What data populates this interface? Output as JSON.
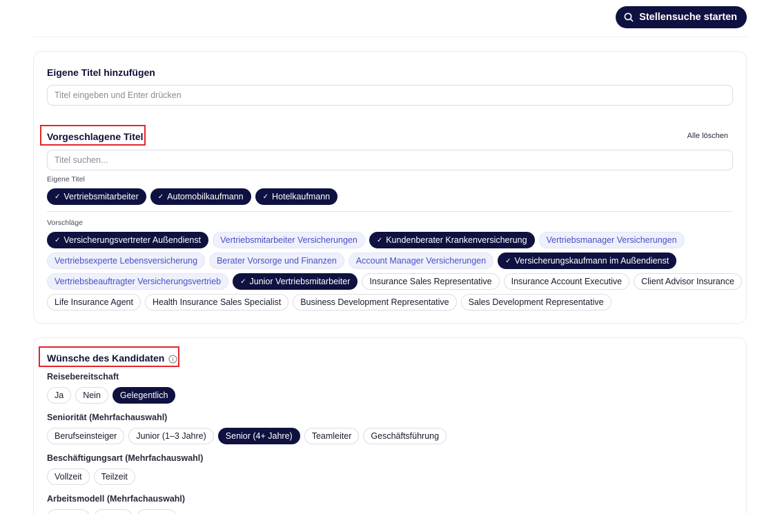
{
  "header": {
    "search_button_label": "Stellensuche starten"
  },
  "custom_titles": {
    "heading": "Eigene Titel hinzufügen",
    "placeholder": "Titel eingeben und Enter drücken"
  },
  "suggested_titles": {
    "heading": "Vorgeschlagene Titel",
    "clear_all": "Alle löschen",
    "search_placeholder": "Titel suchen...",
    "own_label": "Eigene Titel",
    "own": [
      "Vertriebsmitarbeiter",
      "Automobilkaufmann",
      "Hotelkaufmann"
    ],
    "suggestions_label": "Vorschläge",
    "rows": [
      [
        {
          "label": "Versicherungsvertreter Außendienst",
          "state": "selected"
        },
        {
          "label": "Vertriebsmitarbeiter Versicherungen",
          "state": "suggest"
        },
        {
          "label": "Kundenberater Krankenversicherung",
          "state": "selected"
        },
        {
          "label": "Vertriebsmanager Versicherungen",
          "state": "suggest"
        }
      ],
      [
        {
          "label": "Vertriebsexperte Lebensversicherung",
          "state": "suggest"
        },
        {
          "label": "Berater Vorsorge und Finanzen",
          "state": "suggest"
        },
        {
          "label": "Account Manager Versicherungen",
          "state": "suggest"
        },
        {
          "label": "Versicherungskaufmann im Außendienst",
          "state": "selected"
        }
      ],
      [
        {
          "label": "Vertriebsbeauftragter Versicherungsvertrieb",
          "state": "suggest"
        },
        {
          "label": "Junior Vertriebsmitarbeiter",
          "state": "selected"
        },
        {
          "label": "Insurance Sales Representative",
          "state": "plain"
        },
        {
          "label": "Insurance Account Executive",
          "state": "plain"
        },
        {
          "label": "Client Advisor Insurance",
          "state": "plain"
        }
      ],
      [
        {
          "label": "Life Insurance Agent",
          "state": "plain"
        },
        {
          "label": "Health Insurance Sales Specialist",
          "state": "plain"
        },
        {
          "label": "Business Development Representative",
          "state": "plain"
        },
        {
          "label": "Sales Development Representative",
          "state": "plain"
        }
      ]
    ]
  },
  "candidate": {
    "heading": "Wünsche des Kandidaten",
    "travel": {
      "label": "Reisebereitschaft",
      "options": [
        {
          "label": "Ja",
          "state": "plain"
        },
        {
          "label": "Nein",
          "state": "plain"
        },
        {
          "label": "Gelegentlich",
          "state": "selected"
        }
      ]
    },
    "seniority": {
      "label": "Seniorität (Mehrfachauswahl)",
      "options": [
        {
          "label": "Berufseinsteiger",
          "state": "plain"
        },
        {
          "label": "Junior (1–3 Jahre)",
          "state": "plain"
        },
        {
          "label": "Senior (4+ Jahre)",
          "state": "selected"
        },
        {
          "label": "Teamleiter",
          "state": "plain"
        },
        {
          "label": "Geschäftsführung",
          "state": "plain"
        }
      ]
    },
    "employment": {
      "label": "Beschäftigungsart (Mehrfachauswahl)",
      "options": [
        {
          "label": "Vollzeit",
          "state": "plain"
        },
        {
          "label": "Teilzeit",
          "state": "plain"
        }
      ]
    },
    "work_model": {
      "label": "Arbeitsmodell (Mehrfachauswahl)"
    }
  },
  "colors": {
    "primary": "#0f1140",
    "suggest_bg": "#eef0fc",
    "suggest_text": "#4a4fc4",
    "highlight": "#e3262b"
  }
}
